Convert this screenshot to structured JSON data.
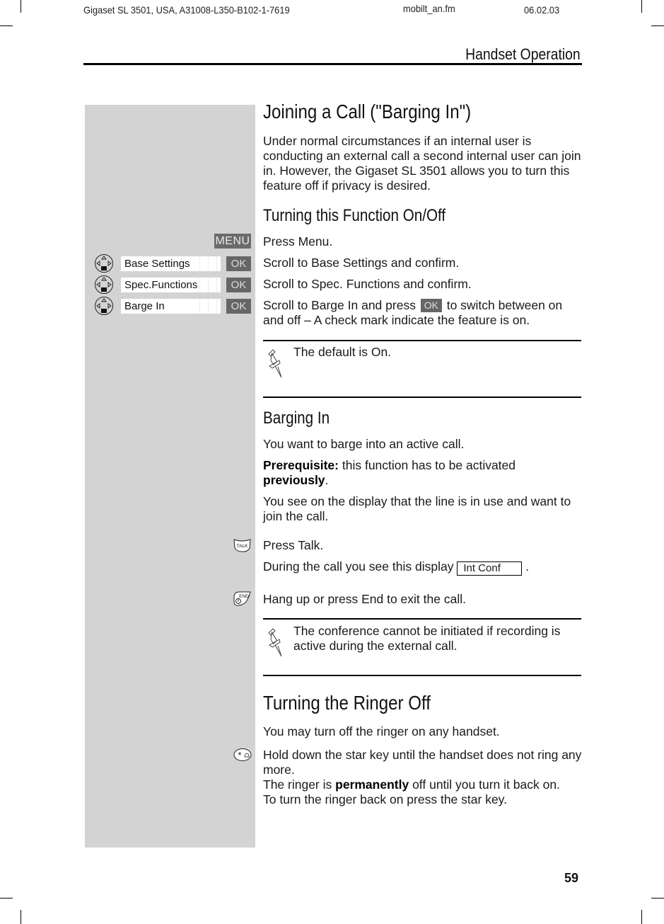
{
  "header": {
    "doc_id": "Gigaset SL 3501, USA, A31008-L350-B102-1-7619",
    "file": "mobilt_an.fm",
    "date": "06.02.03",
    "section": "Handset Operation"
  },
  "joining": {
    "title": "Joining a Call (\"Barging In\")",
    "intro": "Under normal circumstances if an internal user is conducting an external call a second internal user can join in. However, the Gigaset SL 3501 allows you to turn this feature off if privacy is desired.",
    "subtitle": "Turning this Function On/Off",
    "menu_key": "MENU",
    "ok_key": "OK",
    "steps": [
      {
        "text": "Press Menu."
      },
      {
        "display": "Base Settings",
        "text": "Scroll to Base Settings and confirm."
      },
      {
        "display": "Spec.Functions",
        "text": "Scroll to Spec. Functions and confirm."
      },
      {
        "display": "Barge In",
        "text_before": "Scroll to Barge In and press",
        "text_after": "to switch between on and off – A check mark indicate the feature is on."
      }
    ],
    "note": "The default is On."
  },
  "barging": {
    "title": "Barging In",
    "p1": "You want to barge into an active call.",
    "prereq_label": "Prerequisite:",
    "prereq_text": "this function has to be activated",
    "prereq_bold": "previously",
    "p3": "You see on the display that the line is in use and want to join the call.",
    "talk_key": "TALK",
    "talk_text": "Press Talk.",
    "display_text_before": "During the call you see this display",
    "display_value": "Int Conf",
    "display_text_after": ".",
    "end_key": "END",
    "end_text": "Hang up or press End to exit the call.",
    "note": "The conference cannot be initiated if recording is active during the external call."
  },
  "ringer": {
    "title": "Turning the Ringer Off",
    "p1": "You may turn off the ringer on any handset.",
    "star_text_1": "Hold down the star key until the handset does not ring any more.",
    "star_text_2a": "The ringer is",
    "star_text_2b": "permanently",
    "star_text_2c": "off until you turn it back on.",
    "star_text_3": "To turn the ringer back on press the star key."
  },
  "page_number": "59"
}
